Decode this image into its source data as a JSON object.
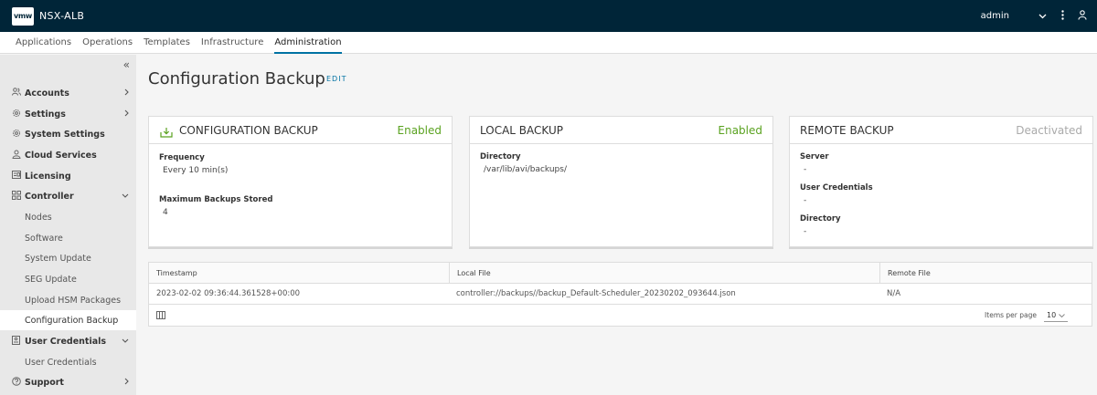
{
  "header": {
    "logo": "vmw",
    "app_title": "NSX-ALB",
    "user": "admin",
    "colors": {
      "bar": "#002538",
      "accent": "#0072a3"
    }
  },
  "topnav": {
    "tabs": [
      {
        "label": "Applications",
        "active": false
      },
      {
        "label": "Operations",
        "active": false
      },
      {
        "label": "Templates",
        "active": false
      },
      {
        "label": "Infrastructure",
        "active": false
      },
      {
        "label": "Administration",
        "active": true
      }
    ]
  },
  "sidebar": {
    "items": [
      {
        "label": "Accounts",
        "icon": "users-icon",
        "chevron": "right"
      },
      {
        "label": "Settings",
        "icon": "gear-icon",
        "chevron": "right"
      },
      {
        "label": "System Settings",
        "icon": "gear-icon"
      },
      {
        "label": "Cloud Services",
        "icon": "cloud-users-icon"
      },
      {
        "label": "Licensing",
        "icon": "license-icon"
      },
      {
        "label": "Controller",
        "icon": "controller-icon",
        "chevron": "down"
      },
      {
        "label": "User Credentials",
        "icon": "credentials-icon",
        "chevron": "down"
      },
      {
        "label": "Support",
        "icon": "help-icon",
        "chevron": "right"
      }
    ],
    "controller_sub": [
      "Nodes",
      "Software",
      "System Update",
      "SEG Update",
      "Upload HSM Packages",
      "Configuration Backup"
    ],
    "credentials_sub": [
      "User Credentials"
    ],
    "active_sub": "Configuration Backup"
  },
  "main": {
    "title": "Configuration Backup",
    "edit_label": "EDIT",
    "cards": {
      "config": {
        "title": "CONFIGURATION BACKUP",
        "status": "Enabled",
        "fields": [
          {
            "label": "Frequency",
            "value": "Every 10 min(s)"
          },
          {
            "label": "Maximum Backups Stored",
            "value": "4"
          }
        ]
      },
      "local": {
        "title": "LOCAL BACKUP",
        "status": "Enabled",
        "fields": [
          {
            "label": "Directory",
            "value": "/var/lib/avi/backups/"
          }
        ]
      },
      "remote": {
        "title": "REMOTE BACKUP",
        "status": "Deactivated",
        "fields": [
          {
            "label": "Server",
            "value": "-"
          },
          {
            "label": "User Credentials",
            "value": "-"
          },
          {
            "label": "Directory",
            "value": "-"
          }
        ]
      }
    },
    "table": {
      "columns": [
        "Timestamp",
        "Local File",
        "Remote File"
      ],
      "rows": [
        [
          "2023-02-02 09:36:44.361528+00:00",
          "controller://backups//backup_Default-Scheduler_20230202_093644.json",
          "N/A"
        ]
      ],
      "items_per_page_label": "Items per page",
      "items_per_page_value": "10"
    }
  }
}
